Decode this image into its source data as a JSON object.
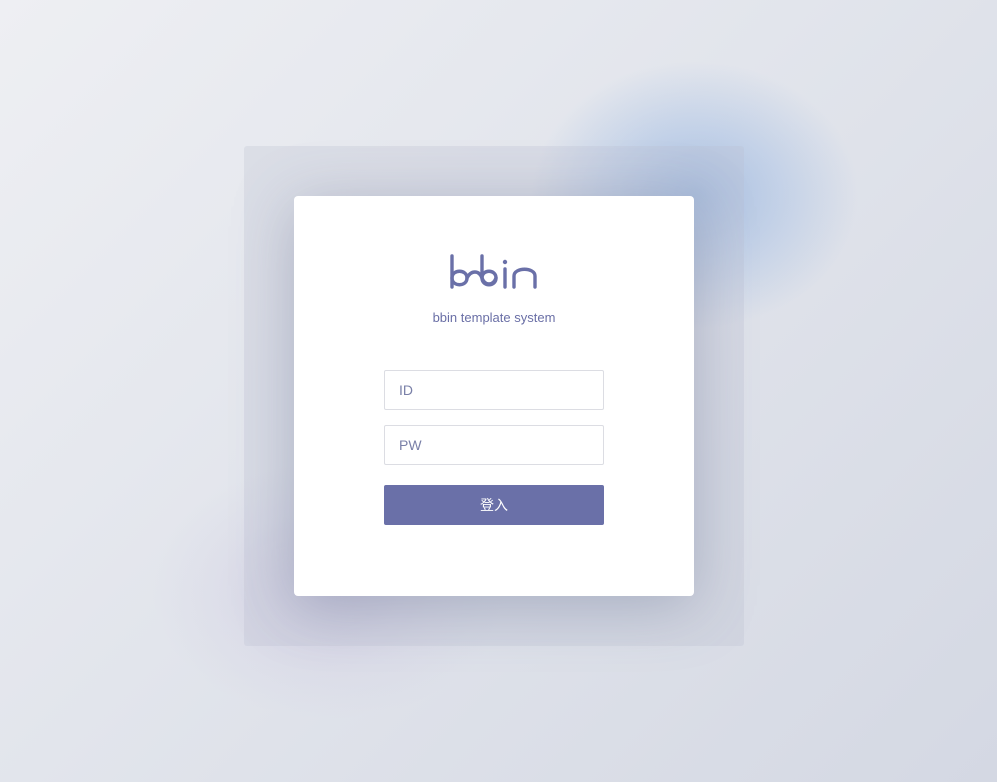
{
  "brand": {
    "logo_text": "bbin",
    "subtitle": "bbin template system",
    "color": "#6a70a8"
  },
  "form": {
    "id_placeholder": "ID",
    "pw_placeholder": "PW",
    "login_label": "登入"
  }
}
